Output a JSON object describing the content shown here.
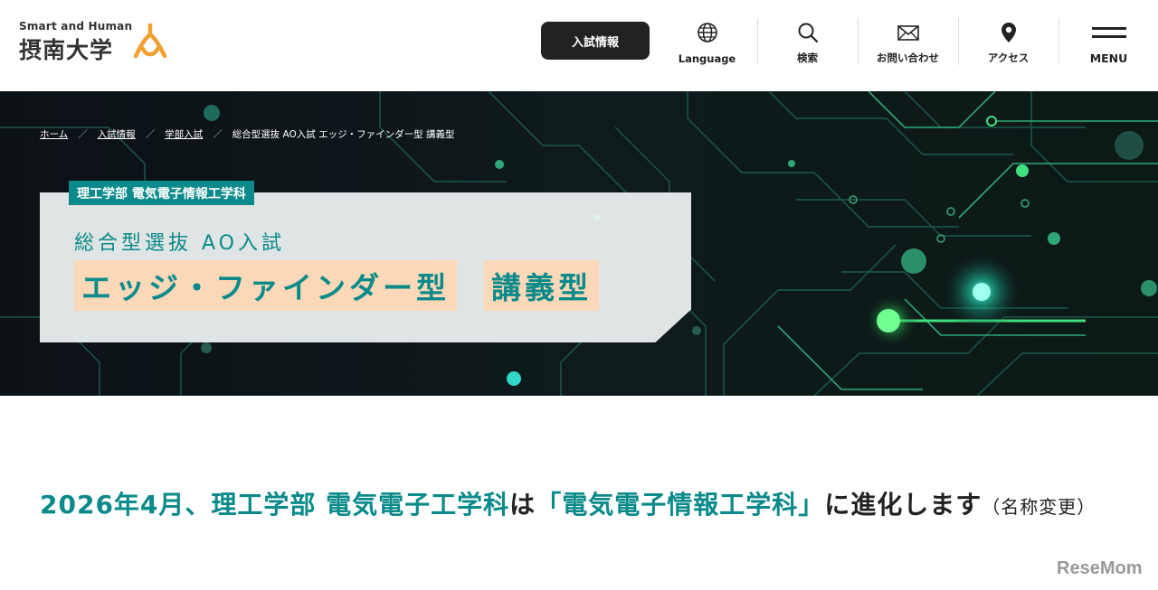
{
  "header": {
    "logo_en": "Smart and Human",
    "logo_ja": "摂南大学",
    "admission_button": "入試情報",
    "nav": [
      {
        "label": "Language",
        "icon": "globe-icon"
      },
      {
        "label": "検索",
        "icon": "search-icon"
      },
      {
        "label": "お問い合わせ",
        "icon": "mail-icon"
      },
      {
        "label": "アクセス",
        "icon": "map-pin-icon"
      },
      {
        "label": "MENU",
        "icon": "hamburger-icon"
      }
    ]
  },
  "breadcrumb": {
    "items": [
      "ホーム",
      "入試情報",
      "学部入試"
    ],
    "current": "総合型選抜 AO入試 エッジ・ファインダー型 講義型",
    "separator": "／"
  },
  "hero": {
    "department": "理工学部 電気電子情報工学科",
    "subtitle": "総合型選抜 AO入試",
    "title_part1": "エッジ・ファインダー型",
    "title_part2": "講義型"
  },
  "headline": {
    "part1": "2026年4月、理工学部 電気電子工学科",
    "part2": "は",
    "part3": "「電気電子情報工学科」",
    "part4": "に進化します",
    "note": "（名称変更）"
  },
  "watermark": "ReseMom",
  "colors": {
    "accent": "#0a8a8a",
    "highlight": "#fbd9b8",
    "button_bg": "#222222",
    "logo_mark": "#f0a030"
  }
}
